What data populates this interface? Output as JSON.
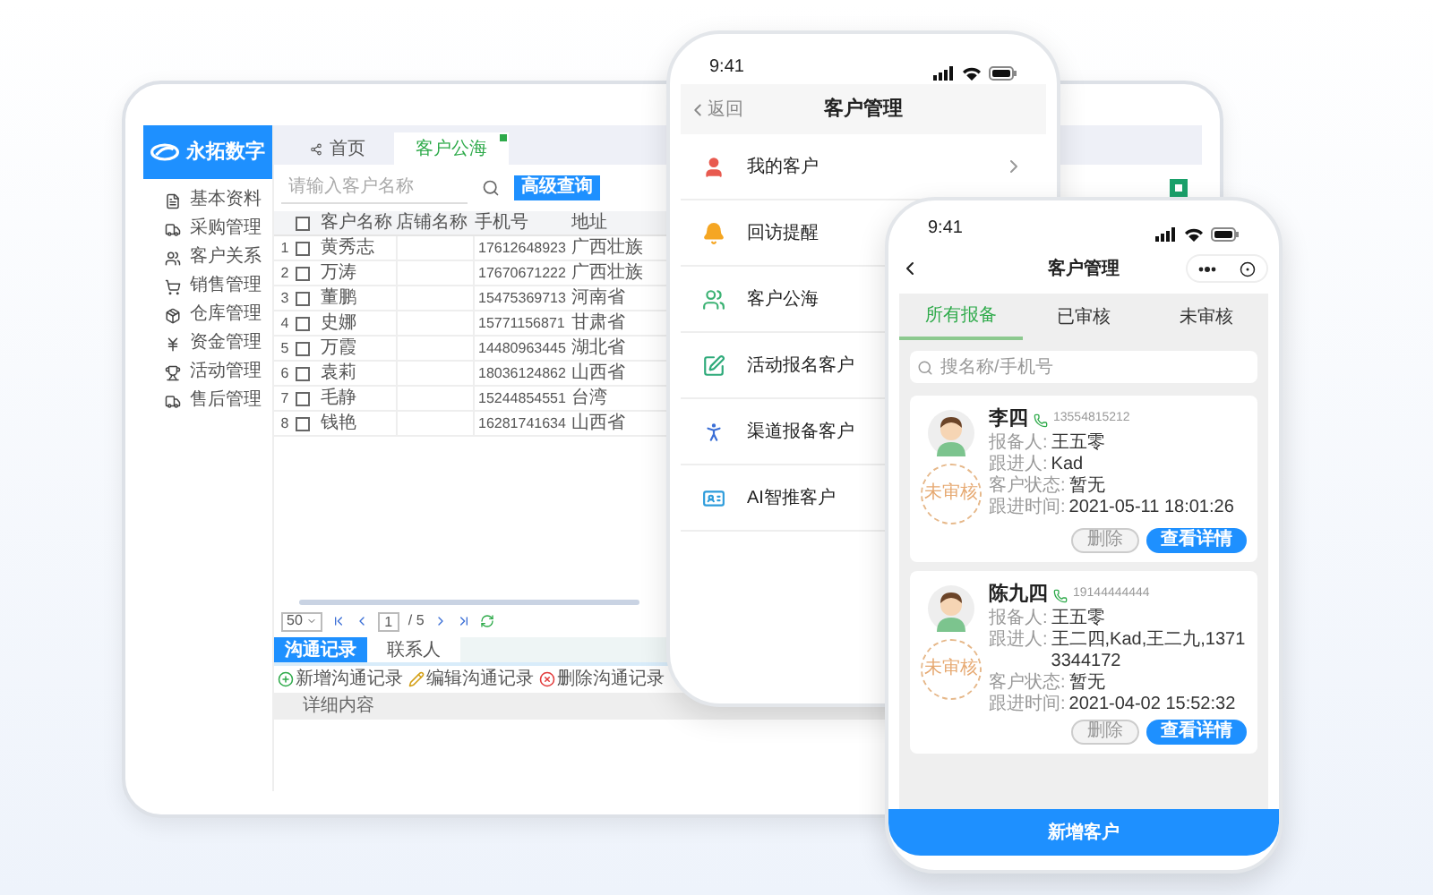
{
  "desktop": {
    "logo": {
      "title": "永拓数字"
    },
    "sidebar": {
      "items": [
        {
          "label": "基本资料"
        },
        {
          "label": "采购管理"
        },
        {
          "label": "客户关系"
        },
        {
          "label": "销售管理"
        },
        {
          "label": "仓库管理"
        },
        {
          "label": "资金管理"
        },
        {
          "label": "活动管理"
        },
        {
          "label": "售后管理"
        }
      ]
    },
    "tabs": [
      {
        "label": "首页",
        "selected": false
      },
      {
        "label": "客户公海",
        "selected": true
      }
    ],
    "search": {
      "placeholder": "请输入客户名称"
    },
    "advanced_search_button": "高级查询",
    "table": {
      "columns": [
        "客户名称",
        "店铺名称",
        "手机号",
        "地址"
      ],
      "header_checked": false,
      "rows": [
        {
          "index": "1",
          "checked": false,
          "name": "黄秀志",
          "phone": "17612648923",
          "address": "广西壮族"
        },
        {
          "index": "2",
          "checked": false,
          "name": "万涛",
          "phone": "17670671222",
          "address": "广西壮族"
        },
        {
          "index": "3",
          "checked": false,
          "name": "董鹏",
          "phone": "15475369713",
          "address": "河南省"
        },
        {
          "index": "4",
          "checked": false,
          "name": "史娜",
          "phone": "15771156871",
          "address": "甘肃省"
        },
        {
          "index": "5",
          "checked": false,
          "name": "万霞",
          "phone": "14480963445",
          "address": "湖北省"
        },
        {
          "index": "6",
          "checked": false,
          "name": "袁莉",
          "phone": "18036124862",
          "address": "山西省"
        },
        {
          "index": "7",
          "checked": false,
          "name": "毛静",
          "phone": "15244854551",
          "address": "台湾"
        },
        {
          "index": "8",
          "checked": false,
          "name": "钱艳",
          "phone": "16281741634",
          "address": "山西省"
        }
      ]
    },
    "pagination": {
      "page_size": "50",
      "page": "1",
      "total": "/ 5"
    },
    "detail_tabs": [
      {
        "label": "沟通记录",
        "selected": true
      },
      {
        "label": "联系人",
        "selected": false
      }
    ],
    "actions": [
      {
        "kind": "add",
        "label": "新增沟通记录"
      },
      {
        "kind": "edit",
        "label": "编辑沟通记录"
      },
      {
        "kind": "delete",
        "label": "删除沟通记录"
      }
    ],
    "detail_header": "详细内容"
  },
  "phone_menu": {
    "time": "9:41",
    "back": "返回",
    "title": "客户管理",
    "items": [
      {
        "label": "我的客户",
        "chevron": true
      },
      {
        "label": "回访提醒",
        "chevron": false
      },
      {
        "label": "客户公海",
        "chevron": false
      },
      {
        "label": "活动报名客户",
        "chevron": false
      },
      {
        "label": "渠道报备客户",
        "chevron": false
      },
      {
        "label": "AI智推客户",
        "chevron": false
      }
    ]
  },
  "phone_reports": {
    "time": "9:41",
    "title": "客户管理",
    "tabs": [
      {
        "label": "所有报备",
        "selected": true
      },
      {
        "label": "已审核",
        "selected": false
      },
      {
        "label": "未审核",
        "selected": false
      }
    ],
    "search": {
      "placeholder": "搜名称/手机号"
    },
    "cards": [
      {
        "name": "李四",
        "phone": "13554815212",
        "stamp": "未审核",
        "details": [
          {
            "label": "报备人:",
            "value": "王五零"
          },
          {
            "label": "跟进人:",
            "value": "Kad"
          },
          {
            "label": "客户状态:",
            "value": "暂无"
          },
          {
            "label": "跟进时间:",
            "value": "2021-05-11 18:01:26"
          }
        ],
        "buttons": [
          "删除",
          "查看详情"
        ]
      },
      {
        "name": "陈九四",
        "phone": "19144444444",
        "stamp": "未审核",
        "details": [
          {
            "label": "报备人:",
            "value": "王五零"
          },
          {
            "label": "跟进人:",
            "value": "王二四,Kad,王二九,13713344172"
          },
          {
            "label": "客户状态:",
            "value": "暂无"
          },
          {
            "label": "跟进时间:",
            "value": "2021-04-02 15:52:32"
          }
        ],
        "buttons": [
          "删除",
          "查看详情"
        ]
      }
    ],
    "add_button": "新增客户"
  }
}
